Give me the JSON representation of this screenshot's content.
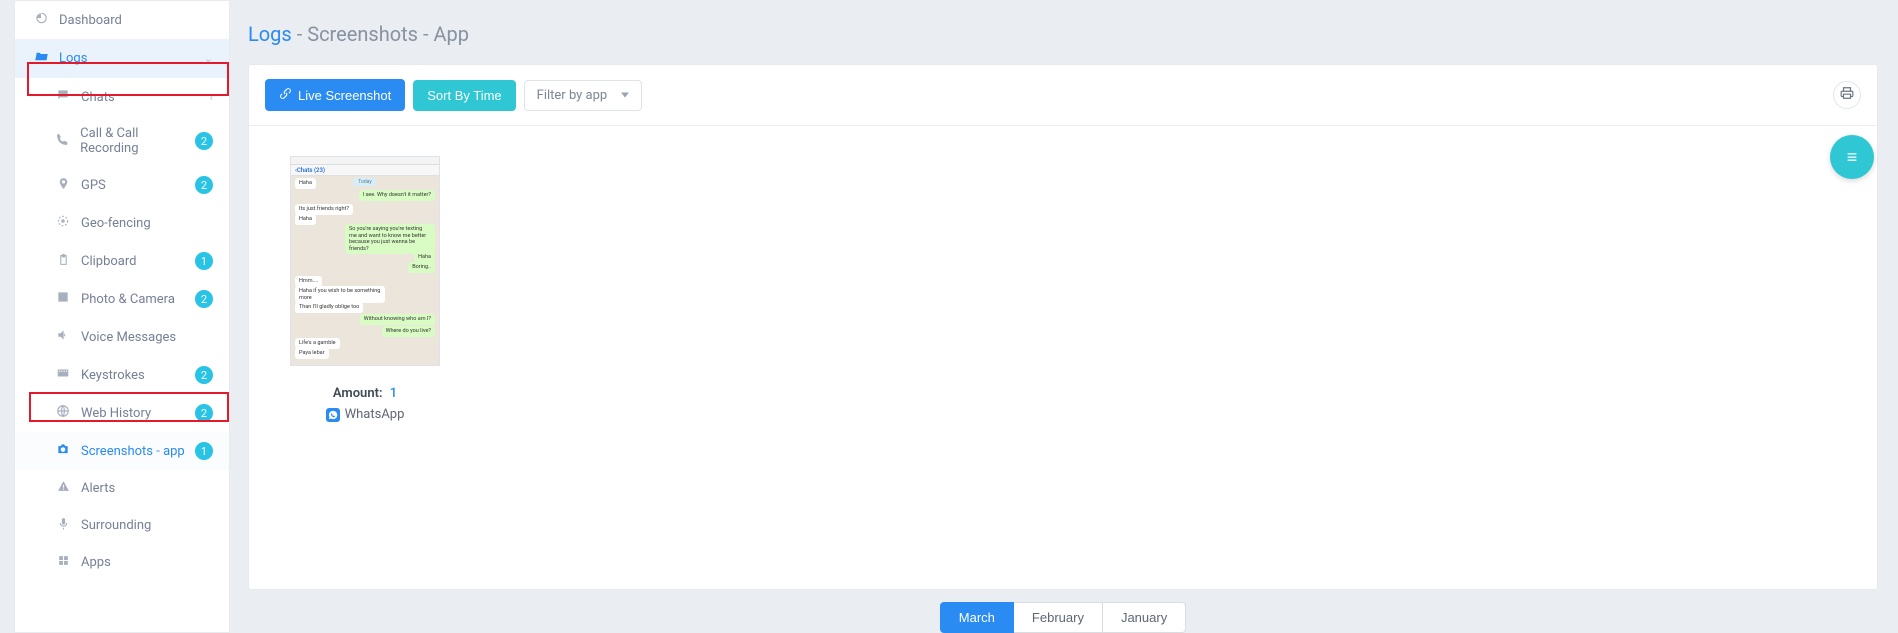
{
  "breadcrumb": {
    "first": "Logs",
    "sep1": " - ",
    "second": "Screenshots",
    "sep2": " - ",
    "third": "App"
  },
  "sidebar": {
    "dashboard": "Dashboard",
    "logs": "Logs",
    "items": [
      {
        "label": "Chats",
        "badge": null,
        "chev": true
      },
      {
        "label": "Call & Call Recording",
        "badge": "2"
      },
      {
        "label": "GPS",
        "badge": "2"
      },
      {
        "label": "Geo-fencing",
        "badge": null
      },
      {
        "label": "Clipboard",
        "badge": "1"
      },
      {
        "label": "Photo & Camera",
        "badge": "2"
      },
      {
        "label": "Voice Messages",
        "badge": null
      },
      {
        "label": "Keystrokes",
        "badge": "2"
      },
      {
        "label": "Web History",
        "badge": "2"
      },
      {
        "label": "Screenshots - app",
        "badge": "1",
        "active": true
      },
      {
        "label": "Alerts",
        "badge": null
      },
      {
        "label": "Surrounding",
        "badge": null
      },
      {
        "label": "Apps",
        "badge": null
      }
    ]
  },
  "toolbar": {
    "live_label": "Live Screenshot",
    "sort_label": "Sort By Time",
    "filter_label": "Filter by app"
  },
  "screenshot": {
    "nav_text": "Chats (23)",
    "today": "Today",
    "bubbles": {
      "b1": "Haha",
      "b2": "I see. Why doesn't it matter?",
      "b3": "Its just friends right?",
      "b4": "Haha",
      "b5": "So you're saying you're texting me and want to know me better because you just wanna be friends?",
      "b6": "Haha",
      "b7": "Boring..",
      "b8": "Hmm....",
      "b9": "Haha if you wish to be something more",
      "b10": "Than I'll gladly oblige too",
      "b11": "Without knowing who am I?",
      "b12": "Where do you live?",
      "b13": "Life's a gamble",
      "b14": "Paya lebar"
    },
    "amount_label": "Amount:",
    "amount_value": "1",
    "app_name": "WhatsApp"
  },
  "months": {
    "m1": "March",
    "m2": "February",
    "m3": "January"
  }
}
